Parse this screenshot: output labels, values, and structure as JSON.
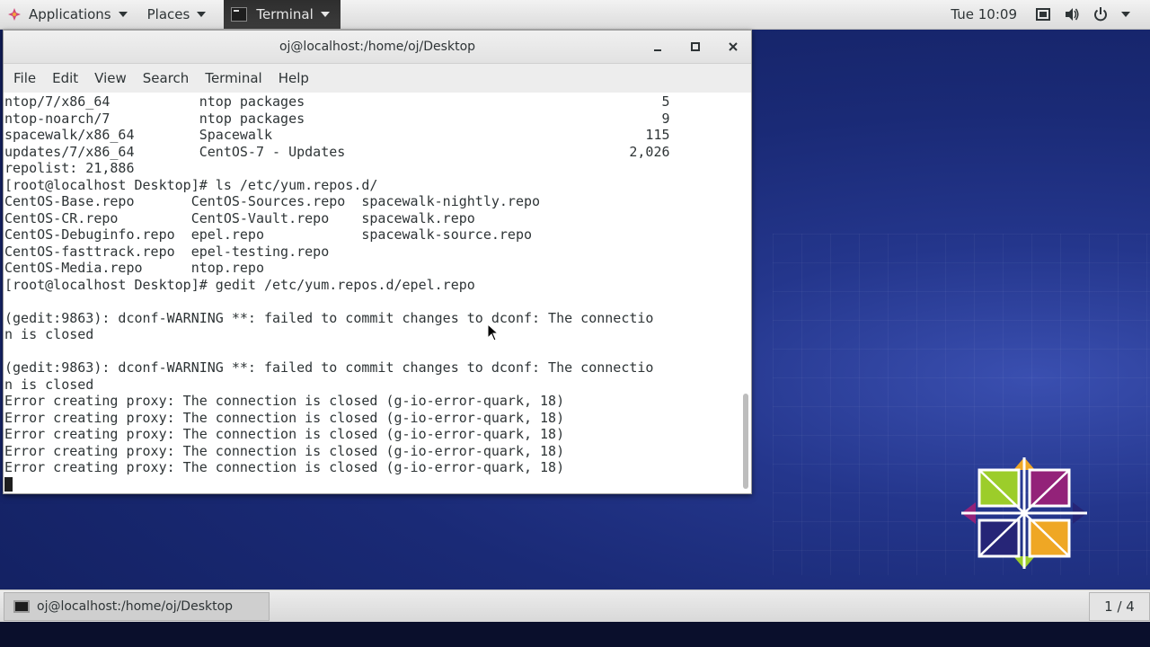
{
  "top_panel": {
    "applications_label": "Applications",
    "places_label": "Places",
    "terminal_label": "Terminal",
    "clock": "Tue 10:09"
  },
  "window": {
    "title": "oj@localhost:/home/oj/Desktop",
    "menu": [
      "File",
      "Edit",
      "View",
      "Search",
      "Terminal",
      "Help"
    ]
  },
  "terminal": {
    "lines": [
      "ntop/7/x86_64           ntop packages                                            5",
      "ntop-noarch/7           ntop packages                                            9",
      "spacewalk/x86_64        Spacewalk                                              115",
      "updates/7/x86_64        CentOS-7 - Updates                                   2,026",
      "repolist: 21,886",
      "[root@localhost Desktop]# ls /etc/yum.repos.d/",
      "CentOS-Base.repo       CentOS-Sources.repo  spacewalk-nightly.repo",
      "CentOS-CR.repo         CentOS-Vault.repo    spacewalk.repo",
      "CentOS-Debuginfo.repo  epel.repo            spacewalk-source.repo",
      "CentOS-fasttrack.repo  epel-testing.repo",
      "CentOS-Media.repo      ntop.repo",
      "[root@localhost Desktop]# gedit /etc/yum.repos.d/epel.repo",
      "",
      "(gedit:9863): dconf-WARNING **: failed to commit changes to dconf: The connectio",
      "n is closed",
      "",
      "(gedit:9863): dconf-WARNING **: failed to commit changes to dconf: The connectio",
      "n is closed",
      "Error creating proxy: The connection is closed (g-io-error-quark, 18)",
      "Error creating proxy: The connection is closed (g-io-error-quark, 18)",
      "Error creating proxy: The connection is closed (g-io-error-quark, 18)",
      "Error creating proxy: The connection is closed (g-io-error-quark, 18)",
      "Error creating proxy: The connection is closed (g-io-error-quark, 18)"
    ]
  },
  "bottom_panel": {
    "task_label": "oj@localhost:/home/oj/Desktop",
    "workspace": "1 / 4"
  },
  "icons": {
    "window_controls": [
      "minimize-icon",
      "maximize-icon",
      "close-icon"
    ],
    "tray": [
      "display-icon",
      "volume-icon",
      "power-icon"
    ]
  },
  "colors": {
    "desktop_blue": "#1a2a76",
    "terminal_bg": "#ffffff",
    "terminal_fg": "#2e3436"
  }
}
